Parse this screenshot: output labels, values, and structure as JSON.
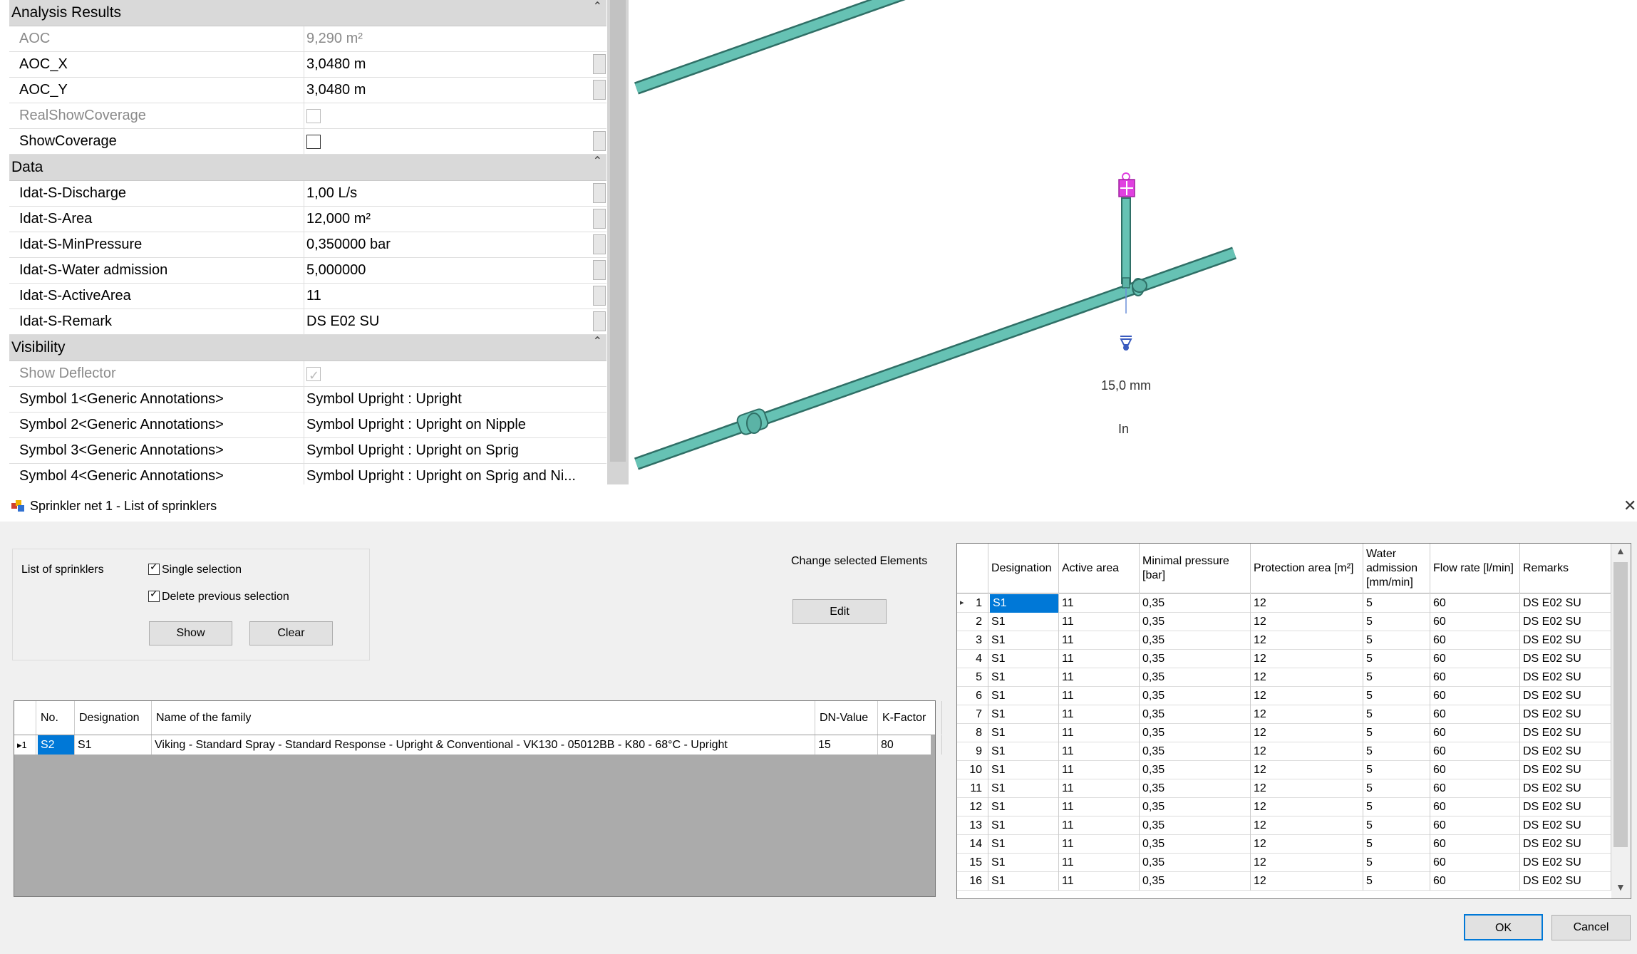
{
  "properties": {
    "groups": {
      "analysis": "Analysis Results",
      "data": "Data",
      "visibility": "Visibility"
    },
    "rows": {
      "aoc": {
        "name": "AOC",
        "value": "9,290 m²"
      },
      "aoc_x": {
        "name": "AOC_X",
        "value": "3,0480 m"
      },
      "aoc_y": {
        "name": "AOC_Y",
        "value": "3,0480 m"
      },
      "real_show_coverage": {
        "name": "RealShowCoverage",
        "checked": false
      },
      "show_coverage": {
        "name": "ShowCoverage",
        "checked": false
      },
      "discharge": {
        "name": "Idat-S-Discharge",
        "value": "1,00 L/s"
      },
      "area": {
        "name": "Idat-S-Area",
        "value": "12,000 m²"
      },
      "min_pressure": {
        "name": "Idat-S-MinPressure",
        "value": "0,350000 bar"
      },
      "water_admission": {
        "name": "Idat-S-Water admission",
        "value": "5,000000"
      },
      "active_area": {
        "name": "Idat-S-ActiveArea",
        "value": "11"
      },
      "remark": {
        "name": "Idat-S-Remark",
        "value": "DS E02 SU"
      },
      "show_deflector": {
        "name": "Show Deflector",
        "checked": true
      },
      "symbol1": {
        "name": "Symbol 1<Generic Annotations>",
        "value": "Symbol Upright : Upright"
      },
      "symbol2": {
        "name": "Symbol 2<Generic Annotations>",
        "value": "Symbol Upright : Upright on Nipple"
      },
      "symbol3": {
        "name": "Symbol 3<Generic Annotations>",
        "value": "Symbol Upright : Upright on Sprig"
      },
      "symbol4": {
        "name": "Symbol 4<Generic Annotations>",
        "value": "Symbol Upright : Upright on Sprig and Ni..."
      }
    }
  },
  "viewport": {
    "size_label": "15,0 mm",
    "in_label": "In",
    "colors": {
      "pipe": "#66c2b4",
      "pipe_edge": "#2f6f66",
      "sprinkler": "#e040e0"
    }
  },
  "dialog": {
    "title": "Sprinkler net 1 - List of sprinklers",
    "list_label": "List of sprinklers",
    "single_selection": {
      "label": "Single selection",
      "checked": true
    },
    "delete_previous": {
      "label": "Delete previous selection",
      "checked": true
    },
    "show_button": "Show",
    "clear_button": "Clear",
    "change_label": "Change selected Elements",
    "edit_button": "Edit",
    "ok_button": "OK",
    "cancel_button": "Cancel",
    "family_table": {
      "headers": {
        "no": "No.",
        "designation": "Designation",
        "family": "Name of the family",
        "dn": "DN-Value",
        "k": "K-Factor"
      },
      "row": {
        "marker": "▸1",
        "no": "S2",
        "designation": "S1",
        "family": "Viking - Standard Spray - Standard Response - Upright & Conventional - VK130 - 05012BB - K80 - 68°C - Upright",
        "dn": "15",
        "k": "80"
      }
    },
    "sprinkler_table": {
      "headers": {
        "designation": "Designation",
        "active_area": "Active area",
        "min_pressure": "Minimal pressure [bar]",
        "protection_area": "Protection area [m²]",
        "water_admission": "Water admission [mm/min]",
        "flow_rate": "Flow rate [l/min]",
        "remarks": "Remarks"
      },
      "rows": [
        {
          "n": "1",
          "d": "S1",
          "a": "11",
          "p": "0,35",
          "pa": "12",
          "w": "5",
          "f": "60",
          "r": "DS E02 SU"
        },
        {
          "n": "2",
          "d": "S1",
          "a": "11",
          "p": "0,35",
          "pa": "12",
          "w": "5",
          "f": "60",
          "r": "DS E02 SU"
        },
        {
          "n": "3",
          "d": "S1",
          "a": "11",
          "p": "0,35",
          "pa": "12",
          "w": "5",
          "f": "60",
          "r": "DS E02 SU"
        },
        {
          "n": "4",
          "d": "S1",
          "a": "11",
          "p": "0,35",
          "pa": "12",
          "w": "5",
          "f": "60",
          "r": "DS E02 SU"
        },
        {
          "n": "5",
          "d": "S1",
          "a": "11",
          "p": "0,35",
          "pa": "12",
          "w": "5",
          "f": "60",
          "r": "DS E02 SU"
        },
        {
          "n": "6",
          "d": "S1",
          "a": "11",
          "p": "0,35",
          "pa": "12",
          "w": "5",
          "f": "60",
          "r": "DS E02 SU"
        },
        {
          "n": "7",
          "d": "S1",
          "a": "11",
          "p": "0,35",
          "pa": "12",
          "w": "5",
          "f": "60",
          "r": "DS E02 SU"
        },
        {
          "n": "8",
          "d": "S1",
          "a": "11",
          "p": "0,35",
          "pa": "12",
          "w": "5",
          "f": "60",
          "r": "DS E02 SU"
        },
        {
          "n": "9",
          "d": "S1",
          "a": "11",
          "p": "0,35",
          "pa": "12",
          "w": "5",
          "f": "60",
          "r": "DS E02 SU"
        },
        {
          "n": "10",
          "d": "S1",
          "a": "11",
          "p": "0,35",
          "pa": "12",
          "w": "5",
          "f": "60",
          "r": "DS E02 SU"
        },
        {
          "n": "11",
          "d": "S1",
          "a": "11",
          "p": "0,35",
          "pa": "12",
          "w": "5",
          "f": "60",
          "r": "DS E02 SU"
        },
        {
          "n": "12",
          "d": "S1",
          "a": "11",
          "p": "0,35",
          "pa": "12",
          "w": "5",
          "f": "60",
          "r": "DS E02 SU"
        },
        {
          "n": "13",
          "d": "S1",
          "a": "11",
          "p": "0,35",
          "pa": "12",
          "w": "5",
          "f": "60",
          "r": "DS E02 SU"
        },
        {
          "n": "14",
          "d": "S1",
          "a": "11",
          "p": "0,35",
          "pa": "12",
          "w": "5",
          "f": "60",
          "r": "DS E02 SU"
        },
        {
          "n": "15",
          "d": "S1",
          "a": "11",
          "p": "0,35",
          "pa": "12",
          "w": "5",
          "f": "60",
          "r": "DS E02 SU"
        },
        {
          "n": "16",
          "d": "S1",
          "a": "11",
          "p": "0,35",
          "pa": "12",
          "w": "5",
          "f": "60",
          "r": "DS E02 SU"
        }
      ]
    }
  }
}
